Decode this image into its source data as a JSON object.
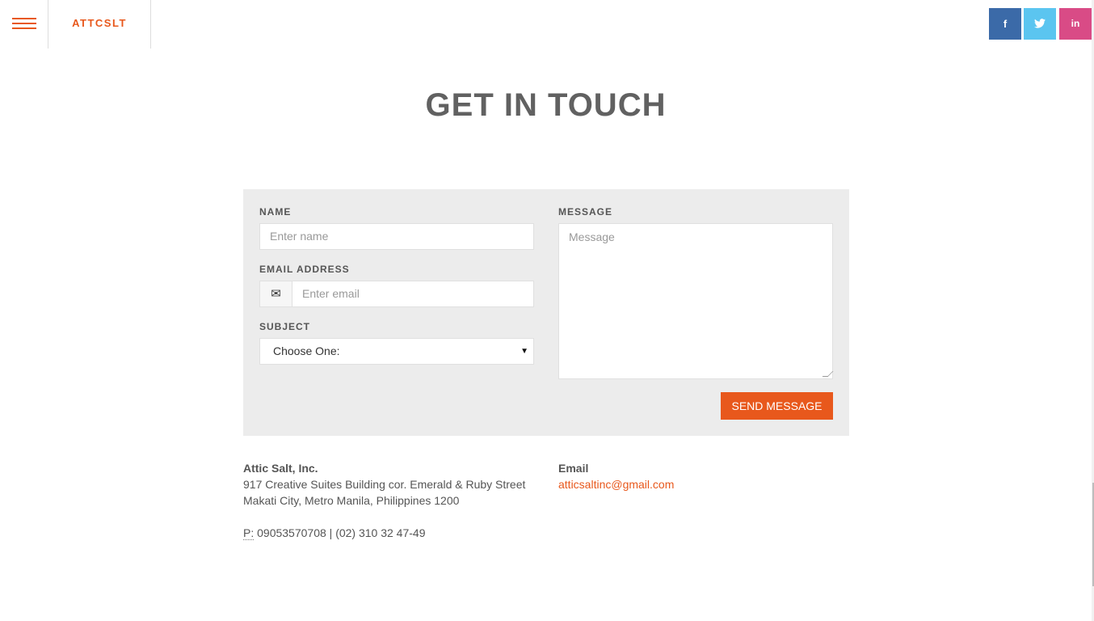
{
  "nav": {
    "brand": "ATTCSLT",
    "social": {
      "facebook": "f",
      "twitter_icon": "twitter-bird",
      "linkedin": "in"
    }
  },
  "page": {
    "title": "GET IN TOUCH"
  },
  "form": {
    "name_label": "NAME",
    "name_placeholder": "Enter name",
    "email_label": "EMAIL ADDRESS",
    "email_placeholder": "Enter email",
    "email_icon": "envelope",
    "subject_label": "SUBJECT",
    "subject_selected": "Choose One:",
    "message_label": "MESSAGE",
    "message_placeholder": "Message",
    "send_label": "SEND MESSAGE"
  },
  "contact": {
    "company": "Attic Salt, Inc.",
    "address_line1": "917 Creative Suites Building cor. Emerald & Ruby Street",
    "address_line2": "Makati City, Metro Manila, Philippines 1200",
    "phone_prefix": "P:",
    "phone": "09053570708 | (02) 310 32 47-49",
    "email_heading": "Email",
    "email": "atticsaltinc@gmail.com"
  },
  "colors": {
    "accent": "#e8581c",
    "facebook": "#3b6aa8",
    "twitter": "#5bc5f0",
    "linkedin": "#d94b86",
    "panel": "#ececec"
  }
}
